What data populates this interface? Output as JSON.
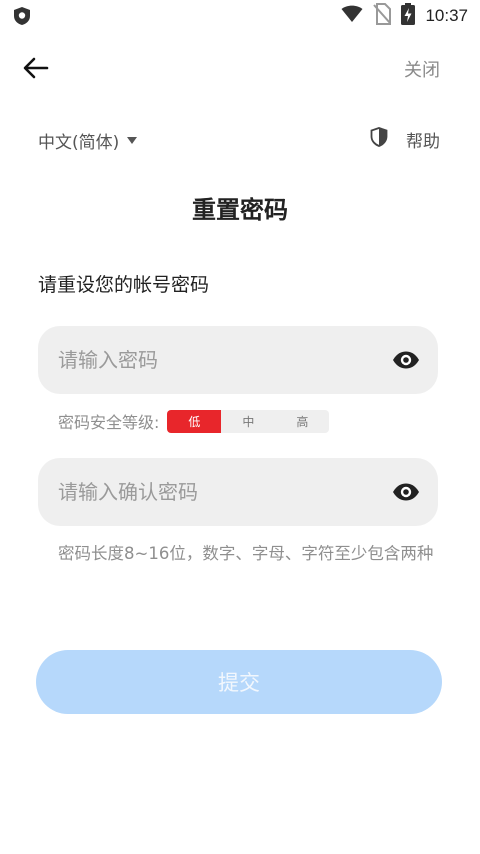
{
  "status_bar": {
    "time": "10:37",
    "icons": [
      "app-shield-icon",
      "wifi-icon",
      "no-sim-icon",
      "battery-charging-icon"
    ]
  },
  "nav": {
    "back_icon": "arrow-left-icon",
    "close_label": "关闭"
  },
  "lang": {
    "selected": "中文(简体)"
  },
  "help": {
    "label": "帮助",
    "icon": "shield-icon"
  },
  "page": {
    "title": "重置密码",
    "subtitle": "请重设您的帐号密码"
  },
  "password": {
    "placeholder": "请输入密码",
    "value": ""
  },
  "strength": {
    "label": "密码安全等级:",
    "levels": [
      "低",
      "中",
      "高"
    ],
    "current": "低"
  },
  "confirm": {
    "placeholder": "请输入确认密码",
    "value": ""
  },
  "hint": "密码长度8~16位，数字、字母、字符至少包含两种",
  "submit_label": "提交",
  "colors": {
    "accent_red": "#e8262b",
    "submit_disabled": "#b6d8fb",
    "field_bg": "#efefef"
  }
}
